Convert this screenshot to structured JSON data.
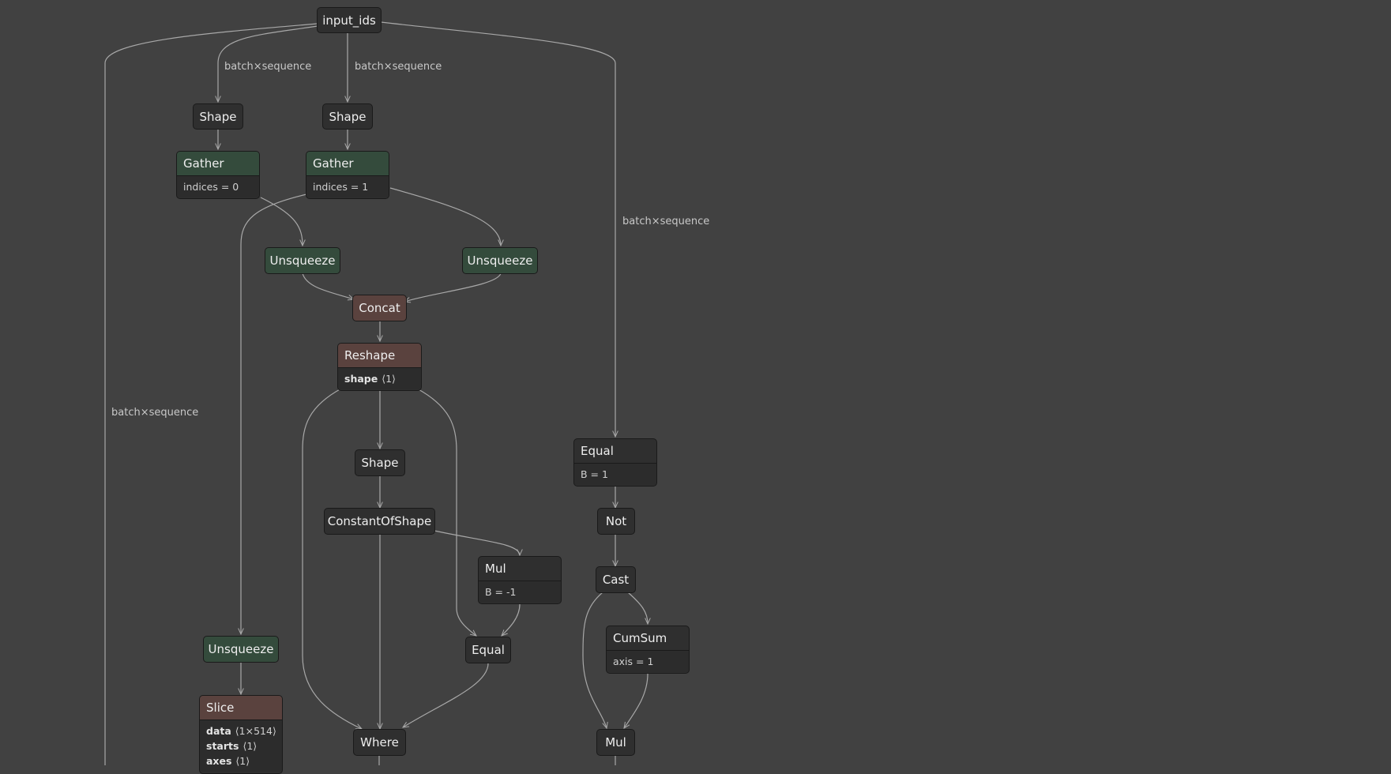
{
  "edge_labels": {
    "left_shape": "batch×sequence",
    "mid_shape": "batch×sequence",
    "right_equal": "batch×sequence",
    "far_left": "batch×sequence"
  },
  "nodes": {
    "input_ids": {
      "title": "input_ids"
    },
    "shape_a": {
      "title": "Shape"
    },
    "shape_b": {
      "title": "Shape"
    },
    "gather_0": {
      "title": "Gather",
      "attr": "indices = 0"
    },
    "gather_1": {
      "title": "Gather",
      "attr": "indices = 1"
    },
    "unsqueeze_a": {
      "title": "Unsqueeze"
    },
    "unsqueeze_b": {
      "title": "Unsqueeze"
    },
    "concat": {
      "title": "Concat"
    },
    "reshape": {
      "title": "Reshape",
      "attr_name": "shape",
      "attr_value": "⟨1⟩"
    },
    "shape_c": {
      "title": "Shape"
    },
    "constant_of_shape": {
      "title": "ConstantOfShape"
    },
    "mul_b": {
      "title": "Mul",
      "attr": "B = -1"
    },
    "equal_mid": {
      "title": "Equal"
    },
    "where": {
      "title": "Where"
    },
    "unsqueeze_c": {
      "title": "Unsqueeze"
    },
    "slice": {
      "title": "Slice",
      "attrs": [
        {
          "name": "data",
          "value": "⟨1×514⟩"
        },
        {
          "name": "starts",
          "value": "⟨1⟩"
        },
        {
          "name": "axes",
          "value": "⟨1⟩"
        }
      ]
    },
    "equal_right": {
      "title": "Equal",
      "attr": "B = 1"
    },
    "not": {
      "title": "Not"
    },
    "cast": {
      "title": "Cast"
    },
    "cumsum": {
      "title": "CumSum",
      "attr": "axis = 1"
    },
    "mul_bottom": {
      "title": "Mul"
    }
  },
  "colors": {
    "background": "#414141",
    "node": "#2f2f2f",
    "green_head": "#344b3c",
    "brown_head": "#5a423e",
    "edge": "#a8a8a8"
  }
}
